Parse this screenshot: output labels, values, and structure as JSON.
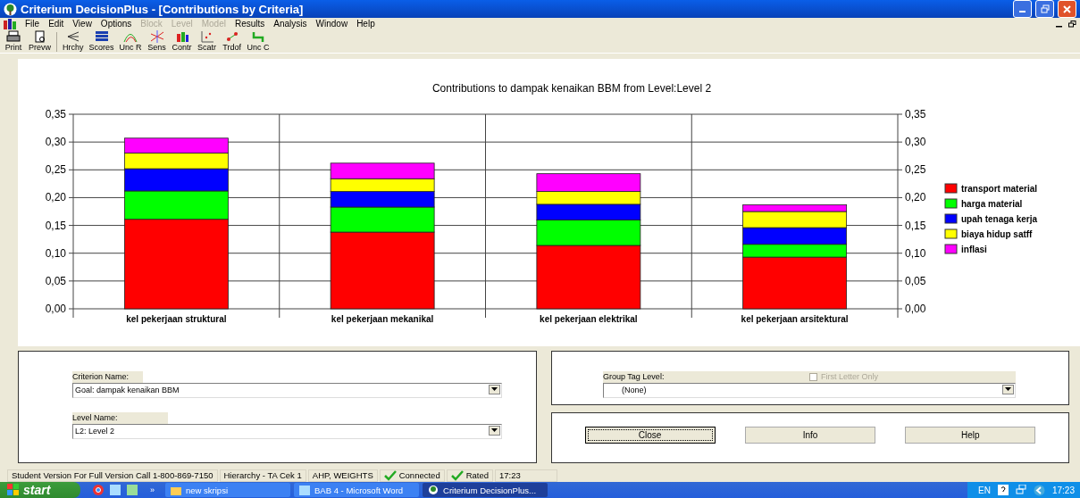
{
  "window": {
    "title": "Criterium DecisionPlus - [Contributions by Criteria]"
  },
  "menu": [
    {
      "label": "File",
      "disabled": false
    },
    {
      "label": "Edit",
      "disabled": false
    },
    {
      "label": "View",
      "disabled": false
    },
    {
      "label": "Options",
      "disabled": false
    },
    {
      "label": "Block",
      "disabled": true
    },
    {
      "label": "Level",
      "disabled": true
    },
    {
      "label": "Model",
      "disabled": true
    },
    {
      "label": "Results",
      "disabled": false
    },
    {
      "label": "Analysis",
      "disabled": false
    },
    {
      "label": "Window",
      "disabled": false
    },
    {
      "label": "Help",
      "disabled": false
    }
  ],
  "toolbar": [
    {
      "label": "Print",
      "kind": "print"
    },
    {
      "label": "Prevw",
      "kind": "preview"
    },
    {
      "label": "Hrchy",
      "kind": "hierarchy"
    },
    {
      "label": "Scores",
      "kind": "scores"
    },
    {
      "label": "Unc R",
      "kind": "uncr"
    },
    {
      "label": "Sens",
      "kind": "sens"
    },
    {
      "label": "Contr",
      "kind": "contr"
    },
    {
      "label": "Scatr",
      "kind": "scatr"
    },
    {
      "label": "Trdof",
      "kind": "trdof"
    },
    {
      "label": "Unc C",
      "kind": "uncc"
    }
  ],
  "chart": {
    "chart_data": {
      "type": "bar",
      "grid": true,
      "legend": "right",
      "title": "Contributions to dampak kenaikan BBM from Level:Level 2",
      "stacked": true,
      "categories": [
        "kel pekerjaan struktural",
        "kel pekerjaan mekanikal",
        "kel pekerjaan elektrikal",
        "kel pekerjaan arsitektural"
      ],
      "ylim": [
        0,
        0.35
      ],
      "yticks": [
        {
          "value": 0,
          "label": "0,00"
        },
        {
          "value": 0.05,
          "label": "0,05"
        },
        {
          "value": 0.1,
          "label": "0,10"
        },
        {
          "value": 0.15,
          "label": "0,15"
        },
        {
          "value": 0.2,
          "label": "0,20"
        },
        {
          "value": 0.25,
          "label": "0,25"
        },
        {
          "value": 0.3,
          "label": "0,30"
        },
        {
          "value": 0.35,
          "label": "0,35"
        }
      ],
      "series": [
        {
          "name": "transport material",
          "color": "#ff0000",
          "values": [
            0.161,
            0.138,
            0.114,
            0.093
          ]
        },
        {
          "name": "harga material",
          "color": "#00ff00",
          "values": [
            0.051,
            0.045,
            0.046,
            0.023
          ]
        },
        {
          "name": "upah tenaga kerja",
          "color": "#0000ff",
          "values": [
            0.04,
            0.028,
            0.028,
            0.03
          ]
        },
        {
          "name": "biaya hidup satff",
          "color": "#ffff00",
          "values": [
            0.028,
            0.023,
            0.023,
            0.029
          ]
        },
        {
          "name": "inflasi",
          "color": "#ff00ff",
          "values": [
            0.027,
            0.028,
            0.032,
            0.012
          ]
        }
      ]
    }
  },
  "criterion": {
    "label": "Criterion Name:",
    "value": "Goal: dampak kenaikan BBM"
  },
  "level": {
    "label": "Level Name:",
    "value": "L2: Level 2"
  },
  "group_tag": {
    "label": "Group Tag Level:",
    "value": "(None)"
  },
  "first_letter": {
    "label": "First Letter Only",
    "checked": false,
    "disabled": true
  },
  "buttons": [
    {
      "label": "Close",
      "focused": true
    },
    {
      "label": "Info",
      "focused": false
    },
    {
      "label": "Help",
      "focused": false
    }
  ],
  "status_bar": [
    {
      "text": "Student Version For Full Version Call 1-800-869-7150",
      "kind": "text"
    },
    {
      "text": "Hierarchy - TA Cek 1",
      "kind": "text"
    },
    {
      "text": "AHP, WEIGHTS",
      "kind": "text"
    },
    {
      "text": "Connected",
      "kind": "check"
    },
    {
      "text": "Rated",
      "kind": "check"
    },
    {
      "text": "17:23",
      "kind": "text"
    }
  ],
  "taskbar": {
    "start": "start",
    "more": "»",
    "tasks": [
      {
        "label": "new skripsi",
        "kind": "folder",
        "selected": false
      },
      {
        "label": "BAB 4 - Microsoft Word",
        "kind": "word",
        "selected": false
      },
      {
        "label": "Criterium DecisionPlus...",
        "kind": "app",
        "selected": true
      }
    ],
    "language": "EN",
    "clock": "17:23"
  }
}
